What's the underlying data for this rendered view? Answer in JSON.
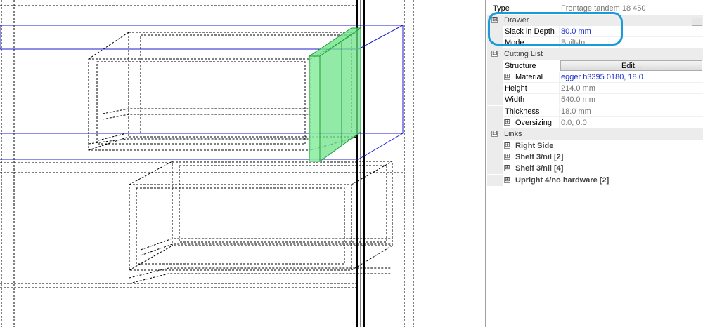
{
  "colors": {
    "selection_fill": "#6fe38a",
    "bounding_lines": "#1c1cd1",
    "highlight_ring": "#1b9ad8",
    "value_blue": "#1a2fd1"
  },
  "properties": {
    "type_row": {
      "name": "Type",
      "value": "Frontage tandem 18 450"
    },
    "drawer": {
      "label": "Drawer",
      "expander": "⊟",
      "ellipsis": "...",
      "slack": {
        "name": "Slack in Depth",
        "value": "80.0 mm"
      },
      "mode": {
        "name": "Mode",
        "value": "Built-In"
      }
    },
    "cutting_list": {
      "label": "Cutting List",
      "expander": "⊟",
      "structure": {
        "name": "Structure",
        "button": "Edit..."
      },
      "material": {
        "name": "Material",
        "value": "egger h3395 0180, 18.0",
        "expander": "⊞"
      },
      "height": {
        "name": "Height",
        "value": "214.0 mm"
      },
      "width": {
        "name": "Width",
        "value": "540.0 mm"
      },
      "thickness": {
        "name": "Thickness",
        "value": "18.0 mm"
      },
      "oversizing": {
        "name": "Oversizing",
        "value": "0.0, 0.0",
        "expander": "⊞"
      }
    },
    "links": {
      "label": "Links",
      "expander": "⊟",
      "items": [
        {
          "label": "Right Side",
          "expander": "⊞"
        },
        {
          "label": "Shelf 3/nil [2]",
          "expander": "⊞"
        },
        {
          "label": "Shelf 3/nil [4]",
          "expander": "⊞"
        },
        {
          "label": "Upright 4/no hardware [2]",
          "expander": "⊞"
        }
      ]
    }
  }
}
